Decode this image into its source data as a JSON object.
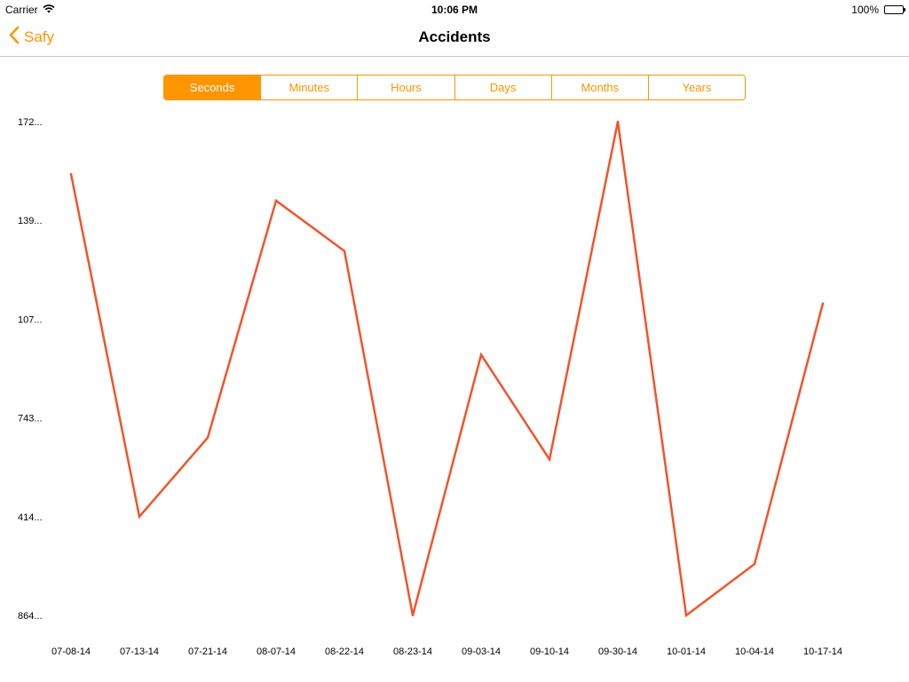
{
  "status_bar": {
    "carrier": "Carrier",
    "time": "10:06 PM",
    "battery": "100%",
    "battery_level": 1.0,
    "wifi_icon": "wifi-icon",
    "battery_icon": "battery-icon"
  },
  "nav": {
    "back_label": "Safy",
    "back_icon": "chevron-left-icon",
    "title": "Accidents"
  },
  "segments": [
    {
      "label": "Seconds",
      "selected": true
    },
    {
      "label": "Minutes",
      "selected": false
    },
    {
      "label": "Hours",
      "selected": false
    },
    {
      "label": "Days",
      "selected": false
    },
    {
      "label": "Months",
      "selected": false
    },
    {
      "label": "Years",
      "selected": false
    }
  ],
  "colors": {
    "accent": "#ff9500",
    "line": "#f4532b"
  },
  "chart_data": {
    "type": "line",
    "x": [
      "07-08-14",
      "07-13-14",
      "07-21-14",
      "08-07-14",
      "08-22-14",
      "08-23-14",
      "09-03-14",
      "09-10-14",
      "09-30-14",
      "10-01-14",
      "10-04-14",
      "10-17-14"
    ],
    "y_tick_labels": [
      "172...",
      "139...",
      "107...",
      "743...",
      "414...",
      "864..."
    ],
    "y_ticks": [
      5,
      4,
      3,
      2,
      1,
      0
    ],
    "ylim": [
      0,
      5
    ],
    "values": [
      4.47,
      1.0,
      1.8,
      4.2,
      3.69,
      0.0,
      2.64,
      1.58,
      5.0,
      0.0,
      0.52,
      3.16
    ],
    "grid": false,
    "title": "",
    "xlabel": "",
    "ylabel": ""
  }
}
